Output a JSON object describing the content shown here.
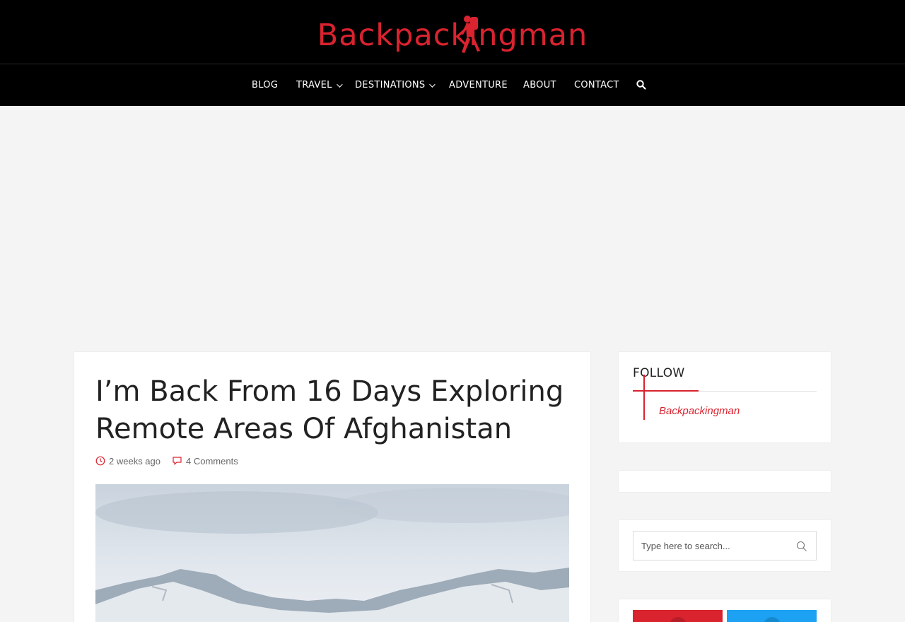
{
  "site": {
    "logo_text": "Backpackingman",
    "brand_color": "#d9232f"
  },
  "nav": {
    "items": [
      {
        "label": "BLOG",
        "has_dropdown": false
      },
      {
        "label": "TRAVEL",
        "has_dropdown": true
      },
      {
        "label": "DESTINATIONS",
        "has_dropdown": true
      },
      {
        "label": "ADVENTURE",
        "has_dropdown": false
      },
      {
        "label": "ABOUT",
        "has_dropdown": false
      },
      {
        "label": "CONTACT",
        "has_dropdown": false
      }
    ],
    "search_icon": "search-icon"
  },
  "article": {
    "title": "I’m Back From 16 Days Exploring Remote Areas Of Afghanistan",
    "date": "2 weeks ago",
    "comments": "4 Comments",
    "date_icon": "clock-icon",
    "comments_icon": "comment-icon"
  },
  "sidebar": {
    "follow": {
      "title": "FOLLOW",
      "link": "Backpackingman"
    },
    "search": {
      "placeholder": "Type here to search..."
    },
    "social": [
      {
        "name": "youtube",
        "color": "#d9232f"
      },
      {
        "name": "twitter",
        "color": "#1da1f2"
      }
    ]
  }
}
